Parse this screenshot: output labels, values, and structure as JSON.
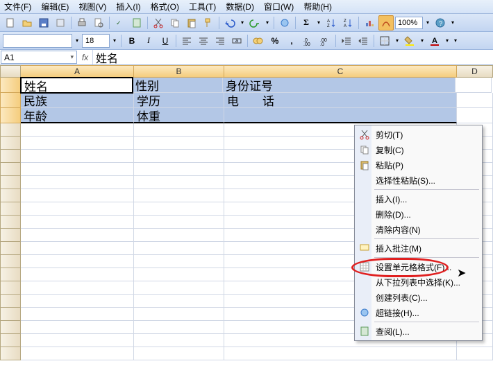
{
  "menu": {
    "file": "文件(F)",
    "edit": "编辑(E)",
    "view": "视图(V)",
    "insert": "插入(I)",
    "format": "格式(O)",
    "tools": "工具(T)",
    "data": "数据(D)",
    "window": "窗口(W)",
    "help": "帮助(H)"
  },
  "toolbar": {
    "zoom": "100%"
  },
  "format": {
    "font_size": "18"
  },
  "namebox": "A1",
  "formula_value": "姓名",
  "columns": [
    "A",
    "B",
    "C",
    "D"
  ],
  "cells": {
    "r1": {
      "A": "姓名",
      "B": "性别",
      "C": "身份证号"
    },
    "r2": {
      "A": "民族",
      "B": "学历",
      "C": "电　　话"
    },
    "r3": {
      "A": "年龄",
      "B": "体重",
      "C": ""
    }
  },
  "context_menu": {
    "cut": "剪切(T)",
    "copy": "复制(C)",
    "paste": "粘贴(P)",
    "paste_special": "选择性粘贴(S)...",
    "insert": "插入(I)...",
    "delete": "删除(D)...",
    "clear": "清除内容(N)",
    "insert_comment": "插入批注(M)",
    "format_cells": "设置单元格格式(F)...",
    "pick_list": "从下拉列表中选择(K)...",
    "create_list": "创建列表(C)...",
    "hyperlink": "超链接(H)...",
    "lookup": "查阅(L)..."
  }
}
